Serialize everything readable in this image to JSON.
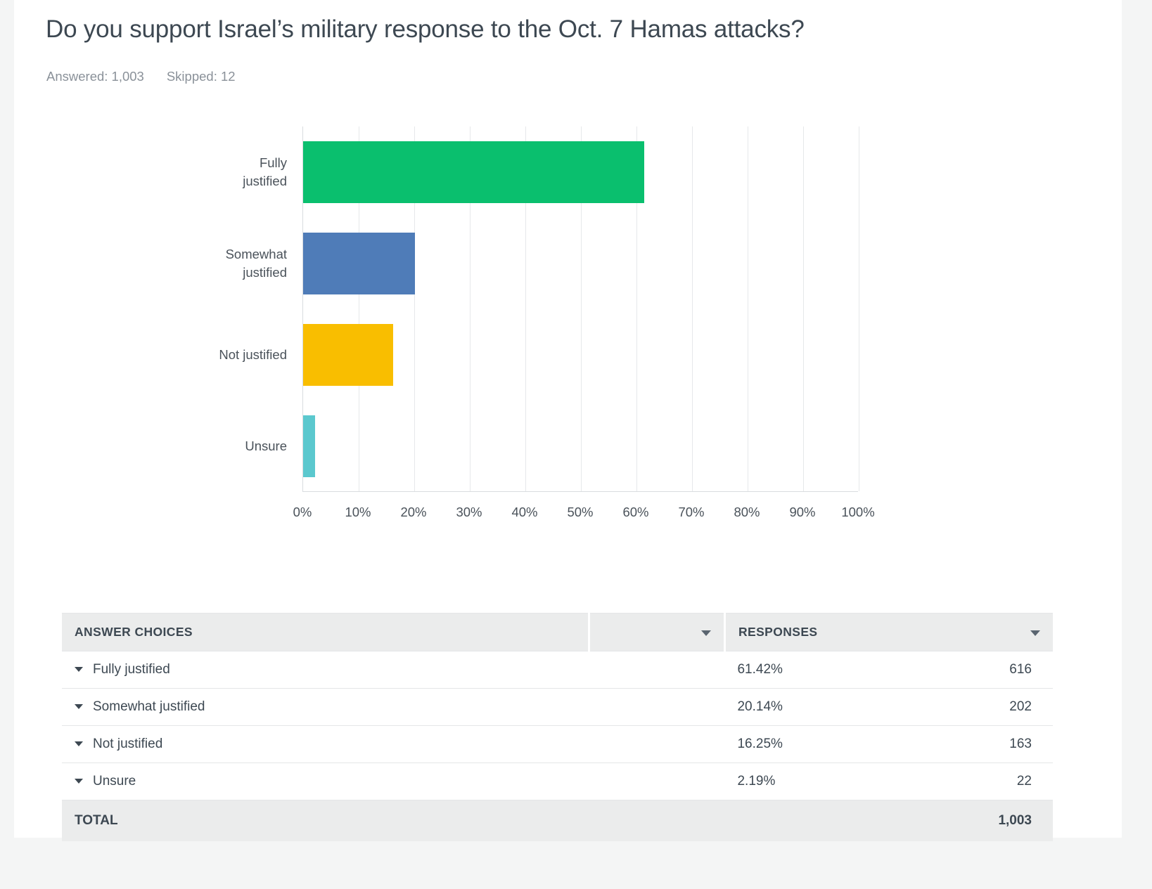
{
  "question": {
    "title": "Do you support Israel’s military response to the Oct. 7 Hamas attacks?",
    "answered_label": "Answered: 1,003",
    "skipped_label": "Skipped: 12"
  },
  "table": {
    "header": {
      "answer_choices": "ANSWER CHOICES",
      "responses": "RESPONSES"
    },
    "rows": [
      {
        "choice": "Fully justified",
        "percent": "61.42%",
        "count": "616"
      },
      {
        "choice": "Somewhat justified",
        "percent": "20.14%",
        "count": "202"
      },
      {
        "choice": "Not justified",
        "percent": "16.25%",
        "count": "163"
      },
      {
        "choice": "Unsure",
        "percent": "2.19%",
        "count": "22"
      }
    ],
    "total": {
      "label": "TOTAL",
      "count": "1,003"
    }
  },
  "chart_data": {
    "type": "bar",
    "orientation": "horizontal",
    "title": "Do you support Israel’s military response to the Oct. 7 Hamas attacks?",
    "categories": [
      "Fully justified",
      "Somewhat justified",
      "Not justified",
      "Unsure"
    ],
    "category_labels_wrapped": [
      [
        "Fully",
        "justified"
      ],
      [
        "Somewhat",
        "justified"
      ],
      [
        "Not justified"
      ],
      [
        "Unsure"
      ]
    ],
    "values": [
      61.42,
      20.14,
      16.25,
      2.19
    ],
    "counts": [
      616,
      202,
      163,
      22
    ],
    "colors": [
      "#0ABF6E",
      "#4F7CB8",
      "#F9BE00",
      "#5BC8CE"
    ],
    "xlabel": "",
    "ylabel": "",
    "xlim": [
      0,
      100
    ],
    "xticks": [
      0,
      10,
      20,
      30,
      40,
      50,
      60,
      70,
      80,
      90,
      100
    ],
    "xtick_labels": [
      "0%",
      "10%",
      "20%",
      "30%",
      "40%",
      "50%",
      "60%",
      "70%",
      "80%",
      "90%",
      "100%"
    ],
    "grid": "vertical",
    "legend": "none"
  }
}
